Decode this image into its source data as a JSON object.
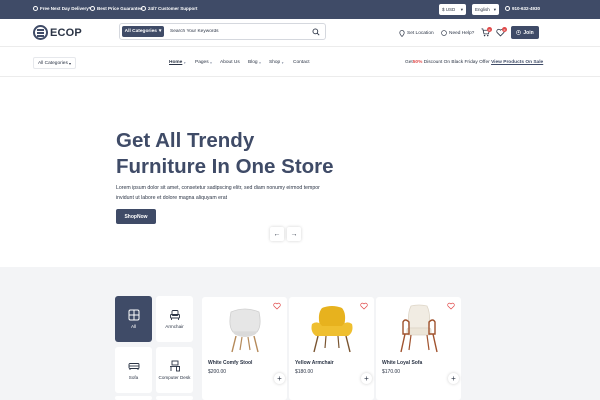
{
  "topbar": {
    "promos": [
      "Free Next Day Delivery*",
      "Best Price Guarantee",
      "24/7 Customer Support"
    ],
    "currency": "$ USD",
    "language": "English",
    "phone": "910-632-4930"
  },
  "header": {
    "logo": "ECOP",
    "search": {
      "category": "All Categories",
      "placeholder": "Search Your Keywords"
    },
    "set_location": "Set Location",
    "need_help": "Need Help?",
    "cart_count": "0",
    "wishlist_count": "0",
    "join": "Join"
  },
  "nav": {
    "all_categories": "All Categories",
    "items": [
      {
        "label": "Home",
        "dropdown": true
      },
      {
        "label": "Pages",
        "dropdown": true
      },
      {
        "label": "About Us",
        "dropdown": false
      },
      {
        "label": "Blog",
        "dropdown": true
      },
      {
        "label": "Shop",
        "dropdown": true
      },
      {
        "label": "Contact",
        "dropdown": false
      }
    ],
    "deal_prefix": "Get",
    "deal_pct": "50%",
    "deal_text": "Discount On Black Friday Offer",
    "deal_link": "View Products On Sale"
  },
  "hero": {
    "title_line1": "Get All Trendy",
    "title_line2": "Furniture In One Store",
    "description_line1": "Lorem ipsum dolor sit amet, consetetur sadipscing elitr, sed diam nonumy eirmod tempor",
    "description_line2": "invidunt ut labore et dolore magna aliquyam erat",
    "cta": "ShopNow"
  },
  "categories": [
    {
      "label": "All",
      "icon": "grid-icon",
      "active": true
    },
    {
      "label": "Armchair",
      "icon": "armchair-icon",
      "active": false
    },
    {
      "label": "Sofa",
      "icon": "sofa-icon",
      "active": false
    },
    {
      "label": "Computer Desk",
      "icon": "desk-icon",
      "active": false
    }
  ],
  "products": [
    {
      "name": "White Comfy Stool",
      "price": "$200.00",
      "color": "#e8e8e8"
    },
    {
      "name": "Yellow Armchair",
      "price": "$180.00",
      "color": "#e7b21e"
    },
    {
      "name": "White Loyal Sofa",
      "price": "$170.00",
      "color": "#f1ece3"
    }
  ],
  "colors": {
    "primary": "#3f4b67",
    "accent_red": "#e04a4a",
    "section_bg": "#f3f4f6"
  }
}
